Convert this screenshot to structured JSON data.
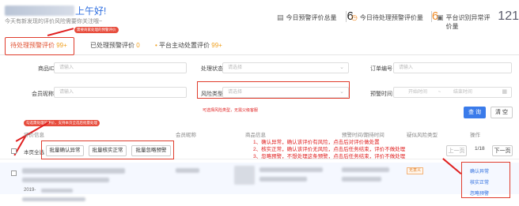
{
  "header": {
    "greeting": "上午好!",
    "subline": "今天有新发现的评价风险需要你关注哦~",
    "stats": [
      {
        "label": "今日预警评价总量",
        "value": "6",
        "icon": "document-icon"
      },
      {
        "label": "今日待处理预警评价量",
        "value": "6",
        "icon": "clock-icon"
      },
      {
        "label": "平台识别异常评价量",
        "value": "121",
        "icon": "shield-icon"
      }
    ]
  },
  "annotations": {
    "tab_note": "需要商家处理的预警评价",
    "risk_note": "可选择风险类型，无需父级客服",
    "batch_note": "勾选需处理的评价，支持本页全选后批量处理",
    "instructions": [
      "1、确认异常，确认该评价有风险，点击后对评价做处置",
      "2、核实正常，确认该评价无风险，点击后任务结束，评价不做处理",
      "3、忽略预警，不想处理这条预警，点击后任务结束，评价不做处理"
    ]
  },
  "tabs": [
    {
      "label": "待处理预警评价",
      "count": "99+"
    },
    {
      "label": "已处理预警评价",
      "count": "0"
    },
    {
      "label": "平台主动处置评价",
      "count": "99+"
    }
  ],
  "filters": {
    "product_id": {
      "label": "商品ID",
      "placeholder": "请输入"
    },
    "process_status": {
      "label": "处理状态",
      "placeholder": "请选择"
    },
    "order_no": {
      "label": "订单编号",
      "placeholder": "请输入"
    },
    "member_name": {
      "label": "会员昵称",
      "placeholder": "请输入"
    },
    "risk_type": {
      "label": "风险类型",
      "placeholder": "请选择"
    },
    "warning_time": {
      "label": "预警时间",
      "start": "开始时间",
      "end": "结束时间"
    }
  },
  "buttons": {
    "query": "查 询",
    "clear": "清 空"
  },
  "table": {
    "headers": [
      "评价信息",
      "会员昵称",
      "商品信息",
      "预警时间/期待时间",
      "疑似风险类型",
      "操作"
    ],
    "select_all": "本页全选",
    "batch": [
      "批量确认异常",
      "批量核实正常",
      "批量忽略预警"
    ],
    "pager": {
      "prev": "上一页",
      "page": "1/18",
      "next": "下一页"
    },
    "row": {
      "date": "2019-",
      "risk_tag": "无意义",
      "actions": [
        "确认异常",
        "核实正常",
        "忽略预警"
      ]
    }
  },
  "colors": {
    "accent": "#3a7bea",
    "annotation": "#e02020",
    "warning": "#f08a24"
  }
}
